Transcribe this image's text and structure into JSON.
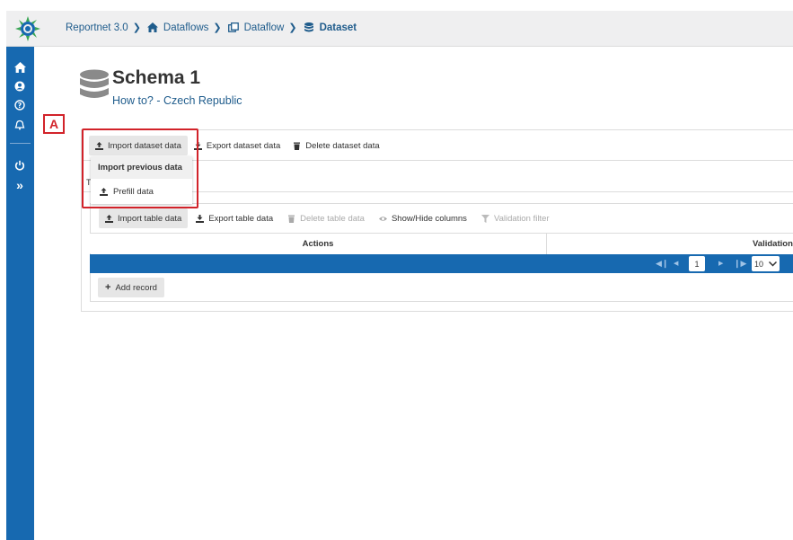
{
  "breadcrumb": {
    "items": [
      "Reportnet 3.0",
      "Dataflows",
      "Dataflow",
      "Dataset"
    ]
  },
  "sidebar": {
    "icons": [
      "home-icon",
      "user-icon",
      "help-icon",
      "bell-icon",
      "power-icon",
      "expand-icon"
    ]
  },
  "header": {
    "title": "Schema 1",
    "subtitle": "How to? - Czech Republic"
  },
  "annotation": {
    "label": "A"
  },
  "dataset_toolbar": {
    "import_label": "Import dataset data",
    "export_label": "Export dataset data",
    "delete_label": "Delete dataset data"
  },
  "dropdown": {
    "header": "Import previous data",
    "item": "Prefill data"
  },
  "tab_fragment": "T",
  "table_toolbar": {
    "import_label": "Import table data",
    "export_label": "Export table data",
    "delete_label": "Delete table data",
    "columns_label": "Show/Hide columns",
    "filter_label": "Validation filter"
  },
  "table": {
    "columns": [
      "Actions",
      "Validation"
    ]
  },
  "paginator": {
    "current_page": "1",
    "rows_per_page": "10"
  },
  "add_record_label": "Add record",
  "colors": {
    "primary": "#1769b0",
    "highlight": "#d2232a"
  }
}
